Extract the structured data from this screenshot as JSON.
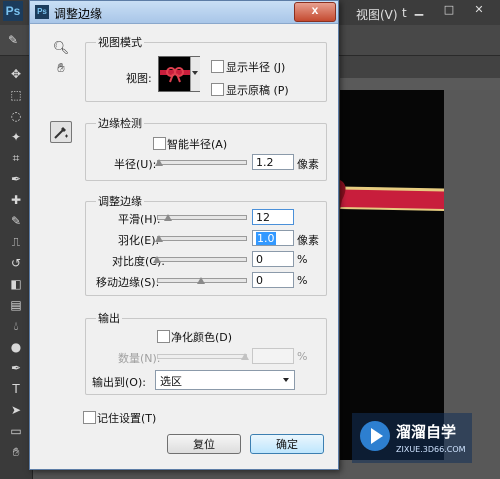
{
  "ps": {
    "logo": "Ps",
    "menu_view": "视图(V)",
    "menu_more": "t",
    "tool_icons": [
      "move-icon",
      "marquee-icon",
      "lasso-icon",
      "magic-wand-icon",
      "crop-icon",
      "eyedropper-icon",
      "healing-brush-icon",
      "brush-icon",
      "clone-stamp-icon",
      "history-brush-icon",
      "eraser-icon",
      "gradient-icon",
      "blur-icon",
      "dodge-icon",
      "pen-icon",
      "type-icon",
      "path-select-icon",
      "shape-icon",
      "hand-icon"
    ],
    "window_buttons": [
      "minimize-icon",
      "maximize-icon",
      "close-icon"
    ]
  },
  "dialog": {
    "title": "调整边缘",
    "close_label": "x",
    "view_mode": {
      "legend": "视图模式",
      "view_label": "视图:",
      "show_radius": "显示半径 (J)",
      "show_original": "显示原稿 (P)"
    },
    "edge_detection": {
      "legend": "边缘检测",
      "smart_radius": "智能半径(A)",
      "radius_label": "半径(U):",
      "radius_value": "1.2",
      "radius_unit": "像素",
      "radius_slider": 0.02
    },
    "adjust_edge": {
      "legend": "调整边缘",
      "smooth_label": "平滑(H):",
      "smooth_value": "12",
      "smooth_slider": 0.12,
      "feather_label": "羽化(E):",
      "feather_value": "1.0",
      "feather_unit": "像素",
      "feather_slider": 0.02,
      "contrast_label": "对比度(C):",
      "contrast_value": "0",
      "contrast_unit": "%",
      "contrast_slider": 0.0,
      "shift_label": "移动边缘(S):",
      "shift_value": "0",
      "shift_unit": "%",
      "shift_slider": 0.5
    },
    "output": {
      "legend": "输出",
      "decontaminate": "净化颜色(D)",
      "amount_label": "数量(N):",
      "amount_unit": "%",
      "output_to_label": "输出到(O):",
      "output_to_value": "选区"
    },
    "remember": "记住设置(T)",
    "reset_button": "复位",
    "ok_button": "确定"
  },
  "watermark": {
    "title": "溜溜自学",
    "subtitle": "ZIXUE.3D66.COM"
  },
  "colors": {
    "selection": "#3399ff",
    "ribbon_red": "#c81e3c",
    "ribbon_gold": "#e6cc80"
  }
}
